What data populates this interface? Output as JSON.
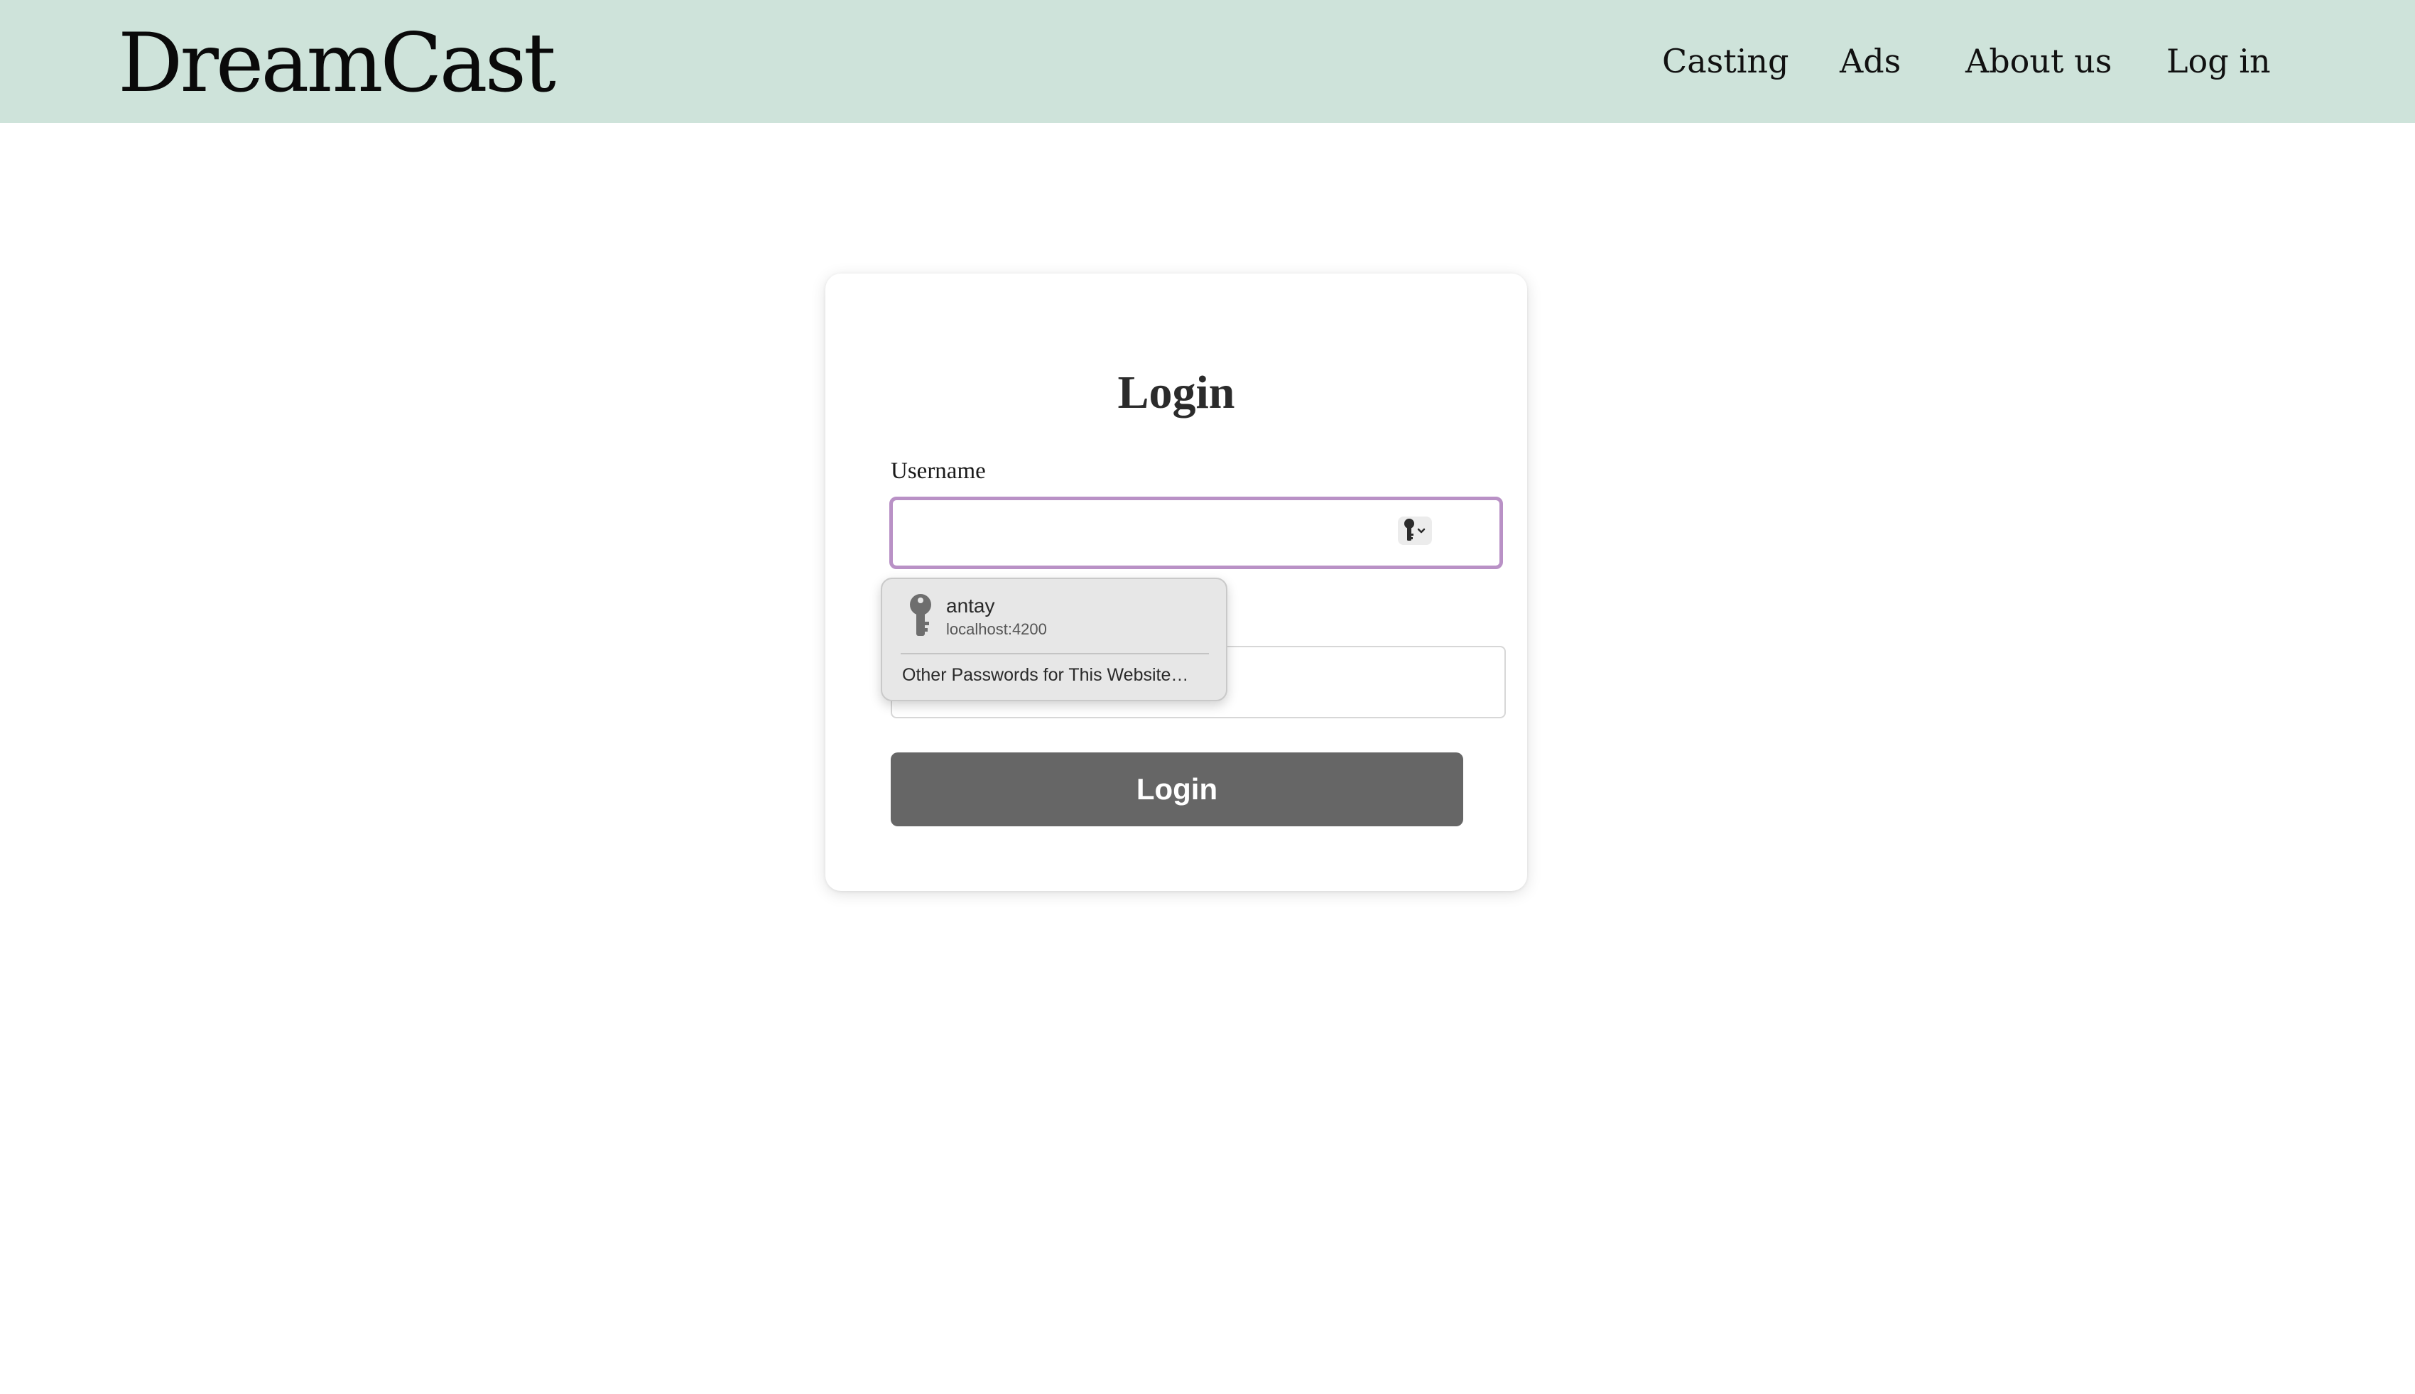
{
  "header": {
    "logo": "DreamCast",
    "nav": {
      "casting": "Casting",
      "ads": "Ads",
      "about": "About us",
      "login": "Log in"
    }
  },
  "login_form": {
    "title": "Login",
    "username_label": "Username",
    "username_value": "",
    "password_value": "",
    "submit_label": "Login"
  },
  "autofill_popup": {
    "account_username": "antay",
    "account_site": "localhost:4200",
    "other_passwords": "Other Passwords for This Website…"
  },
  "colors": {
    "header_bg": "#cee3da",
    "focus_border": "#b991c6",
    "button_bg": "#666666"
  },
  "icons": {
    "username_field": "key-dropdown-icon",
    "autofill_item": "key-icon"
  }
}
